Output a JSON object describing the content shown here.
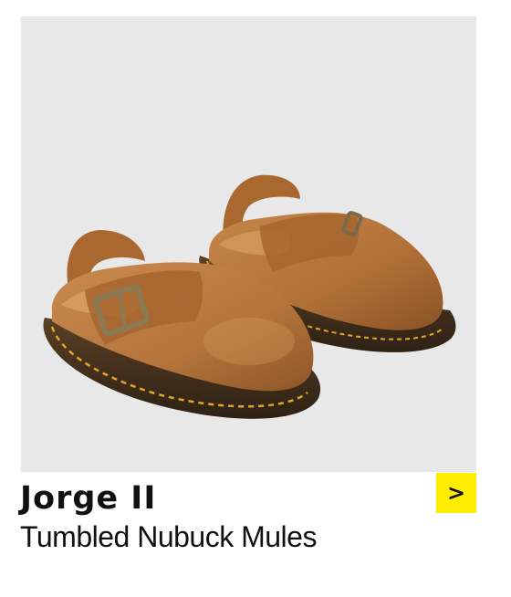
{
  "product": {
    "name": "Jorge II",
    "description": "Tumbled Nubuck Mules",
    "image_alt": "",
    "colors": {
      "accent": "#ffed00",
      "text": "#111111",
      "image_background": "#e8e8e8",
      "leather": "#b8763f",
      "sole": "#4a3420",
      "stitch": "#e0a52a"
    }
  },
  "actions": {
    "next_label": ">",
    "next_icon": "chevron-right-icon"
  }
}
